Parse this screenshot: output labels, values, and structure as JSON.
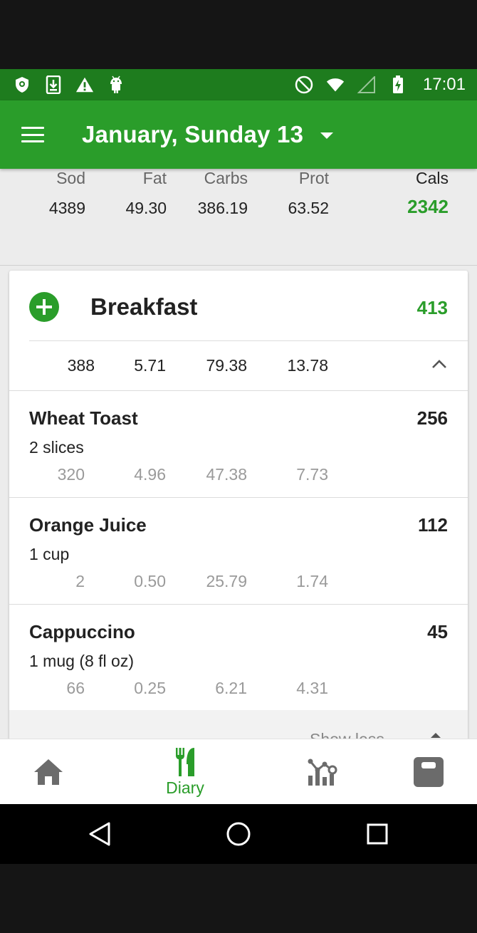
{
  "status_bar": {
    "time": "17:01",
    "left_icons": [
      "shield-icon",
      "download-icon",
      "warning-icon",
      "android-icon"
    ],
    "right_icons": [
      "do-not-disturb-icon",
      "wifi-icon",
      "cell-signal-icon",
      "battery-charging-icon"
    ]
  },
  "app_bar": {
    "menu_icon": "hamburger-menu-icon",
    "date_title": "January, Sunday 13",
    "dropdown_icon": "caret-down-icon"
  },
  "summary": {
    "columns": [
      {
        "label": "Sod",
        "value": "4389"
      },
      {
        "label": "Fat",
        "value": "49.30"
      },
      {
        "label": "Carbs",
        "value": "386.19"
      },
      {
        "label": "Prot",
        "value": "63.52"
      },
      {
        "label": "Cals",
        "value": "2342"
      }
    ]
  },
  "meal": {
    "title": "Breakfast",
    "calories": "413",
    "totals": [
      "388",
      "5.71",
      "79.38",
      "13.78"
    ],
    "collapse_icon": "chevron-up-icon",
    "items": [
      {
        "name": "Wheat Toast",
        "serving": "2 slices",
        "calories": "256",
        "values": [
          "320",
          "4.96",
          "47.38",
          "7.73"
        ]
      },
      {
        "name": "Orange Juice",
        "serving": "1 cup",
        "calories": "112",
        "values": [
          "2",
          "0.50",
          "25.79",
          "1.74"
        ]
      },
      {
        "name": "Cappuccino",
        "serving": "1 mug (8 fl oz)",
        "calories": "45",
        "values": [
          "66",
          "0.25",
          "6.21",
          "4.31"
        ]
      }
    ],
    "show_less": "Show less"
  },
  "bottom_nav": {
    "items": [
      {
        "icon": "home-icon",
        "label": ""
      },
      {
        "icon": "fork-knife-icon",
        "label": "Diary"
      },
      {
        "icon": "chart-icon",
        "label": ""
      },
      {
        "icon": "scale-icon",
        "label": ""
      }
    ]
  },
  "colors": {
    "status_bar": "#1e7c1e",
    "primary": "#2a9d2a",
    "icon_gray": "#6b6b6b"
  }
}
